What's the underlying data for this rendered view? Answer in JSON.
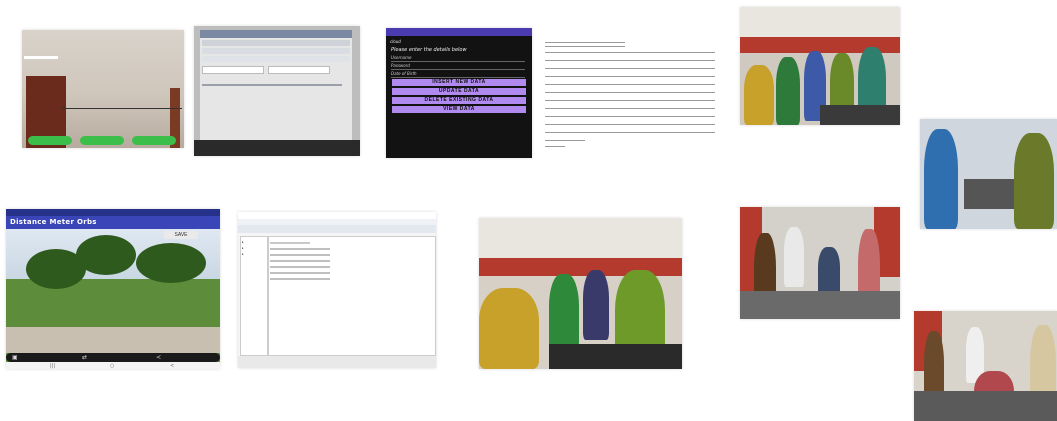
{
  "camera_app": {
    "buttons": [
      "",
      "",
      ""
    ]
  },
  "data_entry_app": {
    "app_name": "cloud",
    "prompt": "Please enter the details below",
    "fields": [
      "Username",
      "Password",
      "Date of Birth"
    ],
    "buttons": [
      "INSERT NEW DATA",
      "UPDATE DATA",
      "DELETE EXISTING DATA",
      "VIEW DATA"
    ]
  },
  "distance_app": {
    "title": "Distance Meter Orbs",
    "save_label": "SAVE",
    "nav": [
      "|||",
      "○",
      "<"
    ]
  },
  "colors": {
    "camera_button": "#3cbf4a",
    "data_button": "#b18af0",
    "distance_appbar": "#3a46b8",
    "photo_curtain": "#b53a2e"
  },
  "icons": [
    "image-icon",
    "share-icon",
    "folder-icon"
  ]
}
